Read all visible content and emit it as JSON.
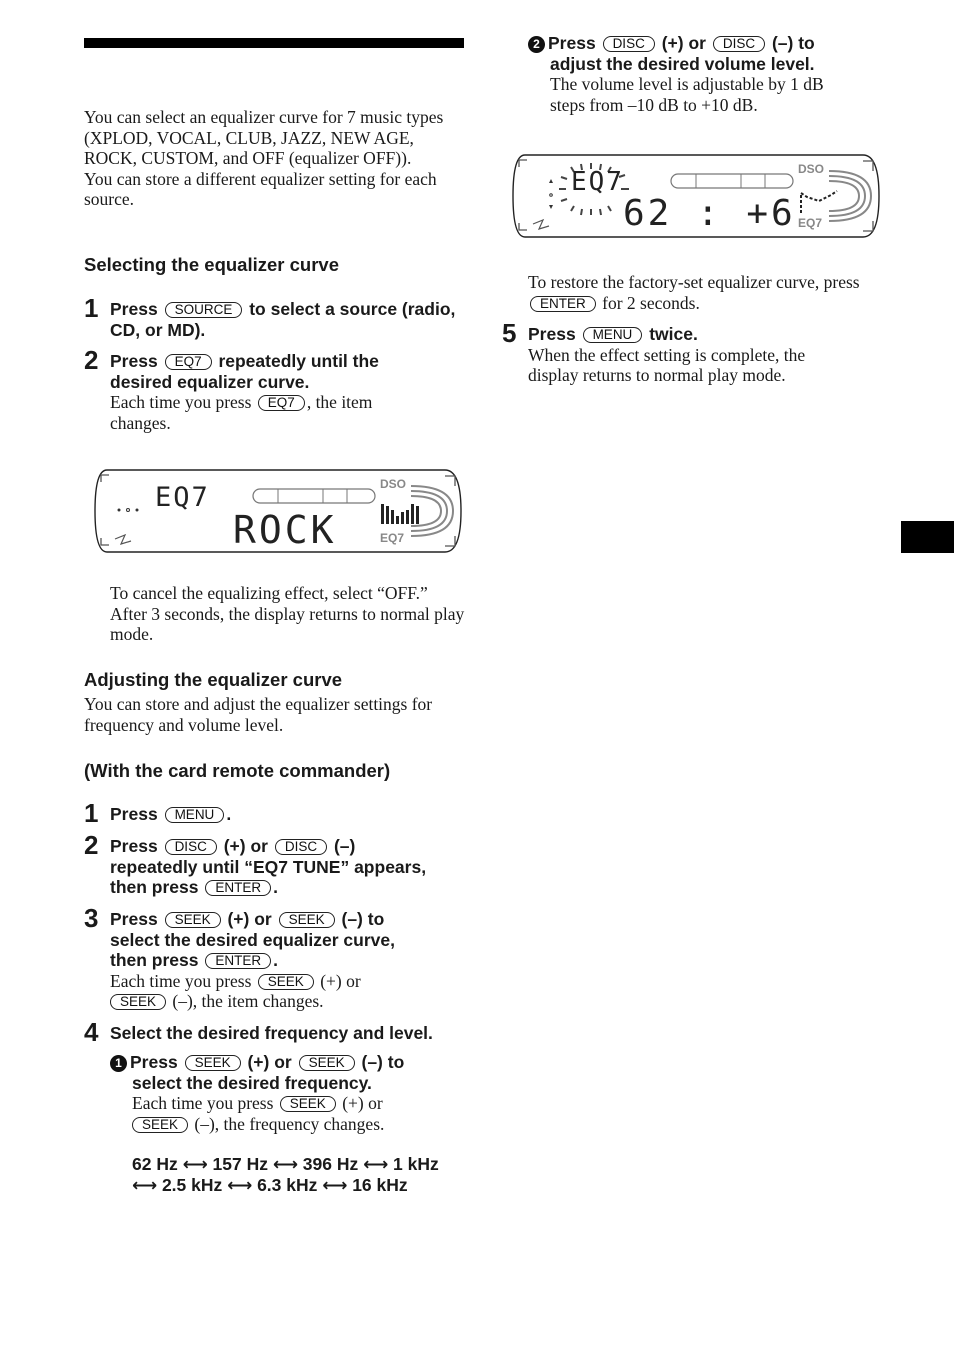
{
  "intro": {
    "paragraph1": "You can select an equalizer curve for 7 music types (XPLOD, VOCAL, CLUB, JAZZ, NEW AGE, ROCK, CUSTOM, and OFF (equalizer OFF)).",
    "paragraph2": "You can store a different equalizer setting for each source."
  },
  "section_select": {
    "heading": "Selecting the equalizer curve",
    "steps": [
      {
        "num": "1",
        "pre": "Press",
        "key": "SOURCE",
        "post": "to select a source (radio, CD, or MD)."
      },
      {
        "num": "2",
        "pre": "Press",
        "key": "EQ7",
        "post": "repeatedly until the desired equalizer curve.",
        "note_pre": "Each time you press",
        "note_key": "EQ7",
        "note_post": ", the item changes."
      }
    ],
    "display": {
      "top_label": "EQ7",
      "main_text": "ROCK",
      "dso_label": "DSO",
      "eq_label": "EQ7"
    },
    "cancel_note": "To cancel the equalizing effect, select “OFF.” After 3 seconds, the display returns to normal play mode."
  },
  "section_adjust": {
    "heading": "Adjusting the equalizer curve",
    "intro": "You can store and adjust the equalizer settings for frequency and volume level.",
    "subheading": "(With the card remote commander)",
    "steps": [
      {
        "num": "1",
        "pre": "Press",
        "key": "MENU",
        "post": "."
      },
      {
        "num": "2",
        "pre": "Press",
        "key1": "DISC",
        "mid": "(+) or",
        "key2": "DISC",
        "post1": "(–)",
        "line2": "repeatedly until “EQ7 TUNE” appears,",
        "line3_pre": "then press",
        "line3_key": "ENTER",
        "line3_post": "."
      },
      {
        "num": "3",
        "pre": "Press",
        "key1": "SEEK",
        "mid": "(+) or",
        "key2": "SEEK",
        "post1": "(–) to",
        "line2": "select the desired equalizer curve,",
        "line3_pre": "then press",
        "line3_key": "ENTER",
        "line3_post": ".",
        "note_pre": "Each time you press",
        "note_key1": "SEEK",
        "note_mid": "(+) or",
        "note_key2": "SEEK",
        "note_post": "(–), the item changes."
      },
      {
        "num": "4",
        "text": "Select the desired frequency and level.",
        "sub1": {
          "marker": "1",
          "pre": "Press",
          "key1": "SEEK",
          "mid": "(+) or",
          "key2": "SEEK",
          "post1": "(–) to",
          "line2": "select the desired frequency.",
          "note_pre": "Each time you press",
          "note_key1": "SEEK",
          "note_mid": "(+) or",
          "note_key2": "SEEK",
          "note_post": "(–), the frequency changes.",
          "freq_line1": "62 Hz ⟷ 157 Hz ⟷ 396 Hz ⟷ 1 kHz",
          "freq_line2": "⟷ 2.5 kHz ⟷ 6.3 kHz ⟷ 16 kHz"
        },
        "sub2": {
          "marker": "2",
          "pre": "Press",
          "key1": "DISC",
          "mid": "(+) or",
          "key2": "DISC",
          "post1": "(–) to",
          "line2": "adjust the desired volume level.",
          "note": "The volume level is adjustable by 1 dB steps from –10 dB to +10 dB."
        }
      }
    ],
    "display2": {
      "top_label": "EQ7",
      "main_text": "62 : +6",
      "dso_label": "DSO",
      "eq_label": "EQ7"
    },
    "restore_pre": "To restore the factory-set equalizer curve, press",
    "restore_key": "ENTER",
    "restore_post": "for 2 seconds.",
    "step5": {
      "num": "5",
      "pre": "Press",
      "key": "MENU",
      "post": "twice.",
      "note": "When the effect setting is complete, the display returns to normal play mode."
    }
  }
}
